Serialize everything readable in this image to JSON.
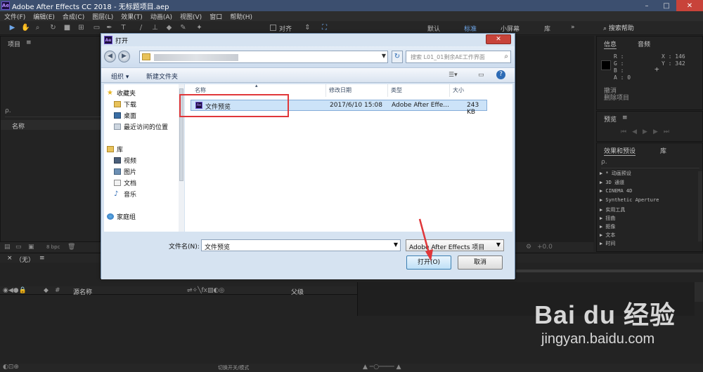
{
  "app": {
    "title": "Adobe After Effects CC 2018 - 无标题项目.aep",
    "logo": "Ae",
    "window_controls": [
      "minimize-icon",
      "maximize-icon",
      "close-icon"
    ]
  },
  "menu": [
    "文件(F)",
    "编辑(E)",
    "合成(C)",
    "图层(L)",
    "效果(T)",
    "动画(A)",
    "视图(V)",
    "窗口",
    "帮助(H)"
  ],
  "toolbar": {
    "align_label": "对齐",
    "workspaces": [
      "默认",
      "标准",
      "小屏幕",
      "库"
    ],
    "active_workspace": "标准",
    "overflow": "»",
    "search_help": "搜索帮助"
  },
  "project_panel": {
    "title": "项目",
    "search_placeholder": "ρ.",
    "column_name": "名称",
    "bpc": "8 bpc"
  },
  "info_panel": {
    "tab_info": "信息",
    "tab_audio": "音频",
    "channels": [
      "R :",
      "G :",
      "B :",
      "A : 0"
    ],
    "x": "X : 146",
    "y": "Y : 342",
    "undo": "撤消",
    "delete_item": "删除项目"
  },
  "preview_panel": {
    "title": "预览"
  },
  "effects_panel": {
    "tab_effects": "效果和预设",
    "tab_library": "库",
    "search_placeholder": "ρ.",
    "items": [
      "▶ * 动画预设",
      "▶ 3D 通道",
      "▶ CINEMA 4D",
      "▶ Synthetic Aperture",
      "▶ 实用工具",
      "▶ 扭曲",
      "▶ 抠像",
      "▶ 文本",
      "▶ 时间"
    ]
  },
  "comp_panel": {
    "close": "×",
    "none_label": "（无）",
    "zoom": "+0.0"
  },
  "timeline": {
    "col_source": "源名称",
    "col_parent": "父级",
    "switch_mode": "切换开关/模式"
  },
  "dialog": {
    "title": "打开",
    "close": "✕",
    "search_placeholder": "搜索 L01_01剩余AE工作界面",
    "organize": "组织 ▾",
    "new_folder": "新建文件夹",
    "nav": {
      "favorites": "收藏夹",
      "downloads": "下载",
      "desktop": "桌面",
      "recent": "最近访问的位置",
      "libraries": "库",
      "videos": "视频",
      "pictures": "图片",
      "documents": "文档",
      "music": "音乐",
      "homegroup": "家庭组"
    },
    "columns": {
      "name": "名称",
      "modified": "修改日期",
      "type": "类型",
      "size": "大小"
    },
    "files": [
      {
        "name": "文件预览",
        "modified": "2017/6/10 15:08",
        "type": "Adobe After Effe...",
        "size": "243 KB"
      }
    ],
    "filename_label": "文件名(N):",
    "filename_value": "文件预览",
    "filetype_value": "Adobe After Effects 项目",
    "open_button": "打开(O)",
    "cancel_button": "取消"
  },
  "watermark": {
    "brand": "Bai du 经验",
    "url": "jingyan.baidu.com"
  },
  "colors": {
    "highlight": "#e0373a",
    "accent": "#6ea6e8"
  }
}
